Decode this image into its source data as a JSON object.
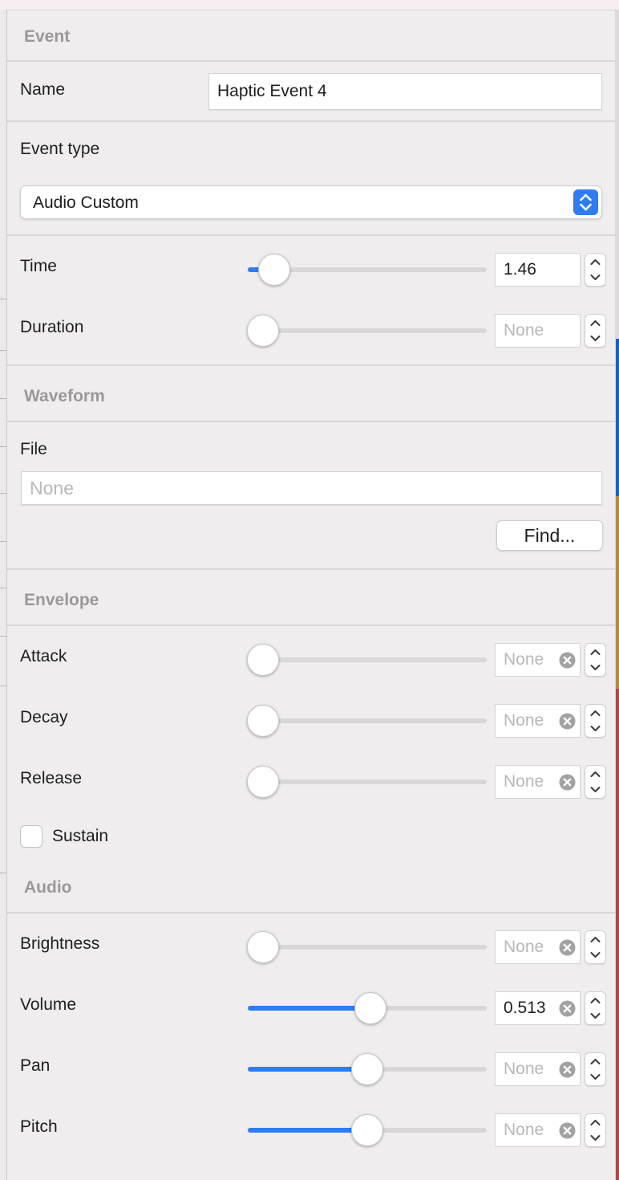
{
  "event": {
    "section_title": "Event",
    "name_label": "Name",
    "name_value": "Haptic Event 4",
    "event_type_label": "Event type",
    "event_type_value": "Audio Custom",
    "time_label": "Time",
    "time_value": "1.46",
    "time_level": 0.11,
    "duration_label": "Duration",
    "duration_placeholder": "None",
    "duration_level": 0
  },
  "waveform": {
    "section_title": "Waveform",
    "file_label": "File",
    "file_placeholder": "None",
    "find_button": "Find..."
  },
  "envelope": {
    "section_title": "Envelope",
    "attack_label": "Attack",
    "attack_placeholder": "None",
    "decay_label": "Decay",
    "decay_placeholder": "None",
    "release_label": "Release",
    "release_placeholder": "None",
    "sustain_label": "Sustain",
    "sustain_checked": false
  },
  "audio": {
    "section_title": "Audio",
    "brightness_label": "Brightness",
    "brightness_placeholder": "None",
    "brightness_level": 0,
    "volume_label": "Volume",
    "volume_value": "0.513",
    "volume_level": 0.513,
    "pan_label": "Pan",
    "pan_placeholder": "None",
    "pan_level": 0.5,
    "pitch_label": "Pitch",
    "pitch_placeholder": "None",
    "pitch_level": 0.5
  },
  "colors": {
    "accent": "#2f7cf6",
    "section_title": "#9a9899",
    "background": "#efedee"
  },
  "icons": [
    "chevron-up-down-icon",
    "clear-icon",
    "stepper-up-icon",
    "stepper-down-icon"
  ]
}
